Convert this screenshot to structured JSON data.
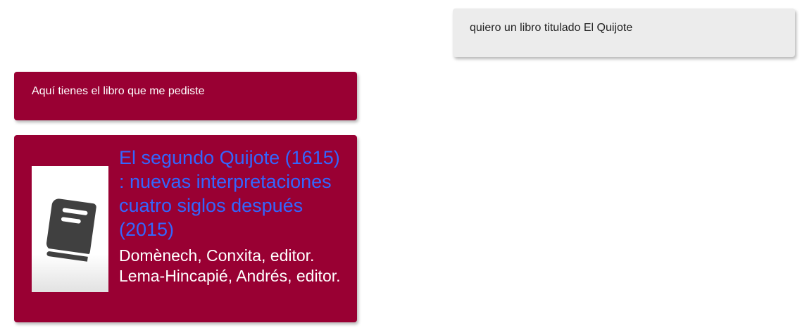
{
  "colors": {
    "user_bubble_bg": "#ececec",
    "bot_bubble_bg": "#990033",
    "title_link": "#3366ff"
  },
  "messages": {
    "user": {
      "text": "quiero un libro titulado El Quijote"
    },
    "bot": {
      "text": "Aquí tienes el libro que me pediste"
    }
  },
  "book": {
    "cover_icon": "book-icon",
    "title": "El segundo Quijote (1615) : nuevas interpretaciones cuatro siglos después (2015)",
    "authors": "Domènech, Conxita, editor. Lema-Hincapié, Andrés, editor."
  }
}
